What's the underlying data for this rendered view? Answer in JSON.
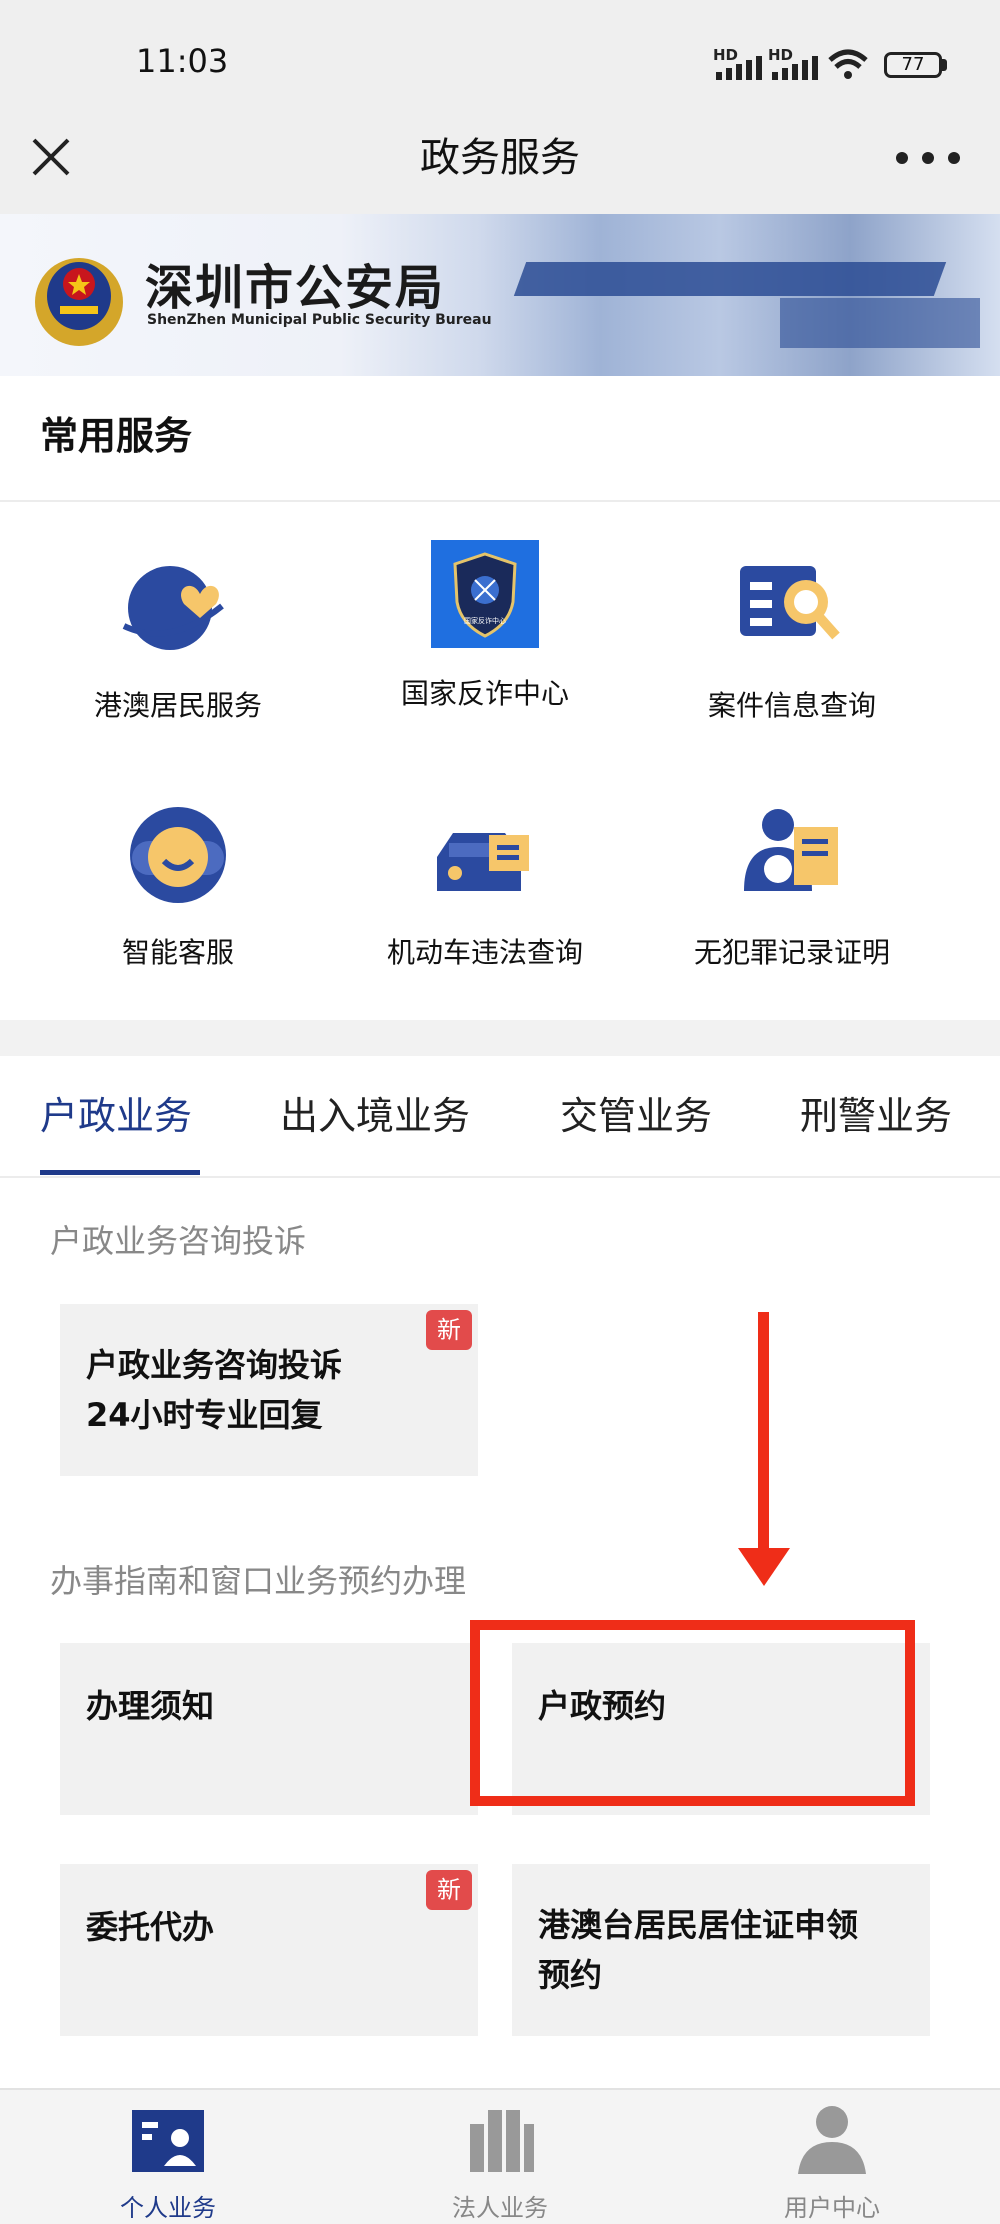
{
  "status_bar": {
    "time": "11:03",
    "signal_labels": [
      "HD",
      "HD"
    ],
    "battery": "77"
  },
  "header": {
    "title": "政务服务"
  },
  "banner": {
    "title": "深圳市公安局",
    "subtitle": "ShenZhen Municipal Public Security Bureau"
  },
  "common_services": {
    "title": "常用服务",
    "items": [
      {
        "label": "港澳居民服务",
        "icon": "planet-heart-icon"
      },
      {
        "label": "国家反诈中心",
        "icon": "shield-badge-icon"
      },
      {
        "label": "案件信息查询",
        "icon": "search-document-icon"
      },
      {
        "label": "智能客服",
        "icon": "robot-face-icon"
      },
      {
        "label": "机动车违法查询",
        "icon": "car-document-icon"
      },
      {
        "label": "无犯罪记录证明",
        "icon": "person-certificate-icon"
      }
    ],
    "badge_text": "国家反诈中心"
  },
  "tabs": [
    {
      "label": "户政业务",
      "active": true
    },
    {
      "label": "出入境业务",
      "active": false
    },
    {
      "label": "交管业务",
      "active": false
    },
    {
      "label": "刑警业务",
      "active": false
    }
  ],
  "section1": {
    "label": "户政业务咨询投诉",
    "card": {
      "line1": "户政业务咨询投诉",
      "line2": "24小时专业回复",
      "badge": "新"
    }
  },
  "section2": {
    "label": "办事指南和窗口业务预约办理",
    "cards": [
      {
        "line1": "办理须知"
      },
      {
        "line1": "户政预约",
        "highlighted": true
      },
      {
        "line1": "委托代办",
        "badge": "新"
      },
      {
        "line1": "港澳台居民居住证申领",
        "line2": "预约"
      }
    ]
  },
  "bottom_nav": [
    {
      "label": "个人业务",
      "active": true
    },
    {
      "label": "法人业务",
      "active": false
    },
    {
      "label": "用户中心",
      "active": false
    }
  ],
  "colors": {
    "brand_blue": "#1f3a8a",
    "accent_red": "#ef2d18",
    "badge_red": "#e24b4b",
    "tab_inactive": "#222222"
  }
}
